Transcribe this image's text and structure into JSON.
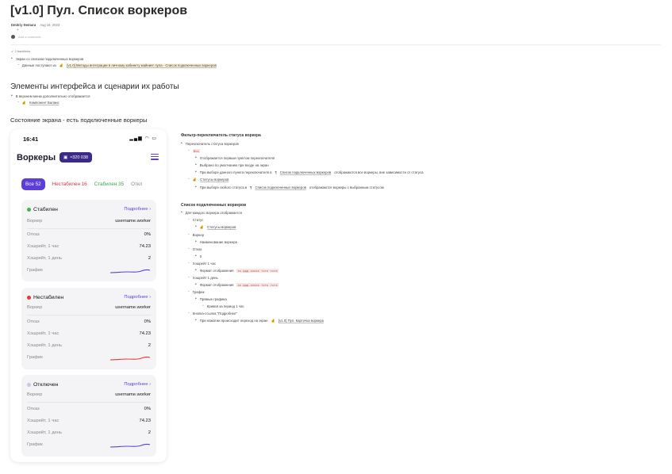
{
  "page": {
    "title": "[v1.0] Пул. Список воркеров",
    "author": "Dmitriy Demura",
    "date": "Aug 16, 2023",
    "add_comment": "Add a comment...",
    "backlinks": "2 backlinks"
  },
  "intro": {
    "item1": "Экран со списком подключенных воркеров",
    "item2_prefix": "Данные поступают из",
    "item2_link": "[v1.0] Методы интеграции в личному кабинету майнинг пула - Список подключенных воркеров"
  },
  "section1": {
    "heading": "Элементы интерфейса и сценарии их работы",
    "item1": "В верхнем меню дополнительно отображается",
    "item1_sub": "Компонент Баланс"
  },
  "section2": {
    "heading": "Состояние экрана - есть подключенные воркеры"
  },
  "phone": {
    "time": "16:41",
    "title": "Воркеры",
    "balance": "≈320 038",
    "filters": {
      "all": "Все",
      "all_count": "52",
      "unstable": "Нестабилен 16",
      "stable": "Стабилен 35",
      "off": "Откл"
    },
    "cards": [
      {
        "state": "Стабилен",
        "color": "#4caf50",
        "more": "Подробнее",
        "worker_label": "Воркер",
        "worker": "username.worker",
        "reject_label": "Отказ",
        "reject": "0%",
        "h1_label": "Хэшрейт, 1 час",
        "h1": "74.23",
        "hd_label": "Хэшрейт, 1 день",
        "hd": "2",
        "graph_label": "График",
        "graph_color": "#5b3fd6"
      },
      {
        "state": "Нестабилен",
        "color": "#e53935",
        "more": "Подробнее",
        "worker_label": "Воркер",
        "worker": "username.worker",
        "reject_label": "Отказ",
        "reject": "0%",
        "h1_label": "Хэшрейт, 1 час",
        "h1": "74.23",
        "hd_label": "Хэшрейт, 1 день",
        "hd": "2",
        "graph_label": "График",
        "graph_color": "#e53935"
      },
      {
        "state": "Отключен",
        "color": "#c9c7e6",
        "more": "Подробнее",
        "worker_label": "Воркер",
        "worker": "username.worker",
        "reject_label": "Отказ",
        "reject": "0%",
        "h1_label": "Хэшрейт, 1 час",
        "h1": "74.23",
        "hd_label": "Хэшрейт, 1 день",
        "hd": "2",
        "graph_label": "График",
        "graph_color": "#5b3fd6"
      }
    ]
  },
  "notes": {
    "filter_head": "Фильтр-переключатель статуса воркера",
    "filter_l1": "Переключатель статуса воркеров",
    "filter_all": "Все",
    "filter_all_1": "Отображается первым пунктом переключателя",
    "filter_all_2": "Выбрано по умолчанию при входе на экран",
    "filter_all_3_prefix": "При выборе данного пункта переключателя в",
    "filter_all_3_link": "Список подключенных воркеров",
    "filter_all_3_suffix": "отображаются все воркеры, вне зависимости от статуса",
    "filter_statuses": "Статусы воркеров",
    "filter_statuses_1_prefix": "При выборе любого статуса в",
    "filter_statuses_1_link": "Список подключенных воркеров",
    "filter_statuses_1_suffix": "отображаются воркеры с выбранным статусом",
    "list_head": "Список подключенных воркеров",
    "list_l1": "Для каждого воркера отображается",
    "status": "Статус",
    "status_link": "Статусы воркеров",
    "worker": "Воркер",
    "worker_name": "Наименование воркера",
    "reject": "Отказ",
    "reject_val": "0",
    "h1": "Хэшрейт 1 час",
    "h1_format": "Формат отображения",
    "h1_code": "xx ддд.ххххх тхтх тхтх",
    "hd": "Хэшрейт 1 день",
    "hd_format": "Формат отображения",
    "hd_code": "xx ддд.ххххх тхтх тхтх",
    "graph": "График",
    "graph_line": "Прямые графика",
    "graph_curve": "Кривая за период 1 час",
    "button": "Кнопка-ссылка \"Подробнее\"",
    "button_prefix": "При нажатии происходит переход на экран",
    "button_link": "[v1.0] Пул. Карточка воркера"
  }
}
